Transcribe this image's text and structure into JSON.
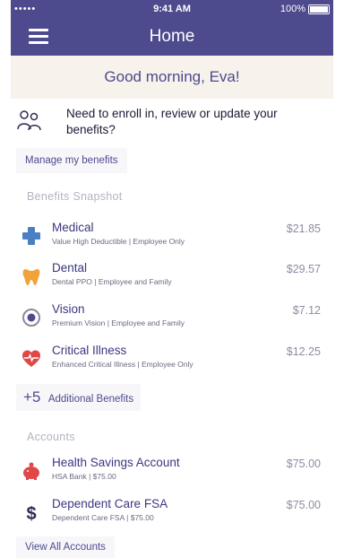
{
  "status": {
    "signal": "••••• ",
    "time": "9:41 AM",
    "battery": "100%"
  },
  "nav": {
    "title": "Home"
  },
  "greeting": "Good morning, Eva!",
  "enroll": {
    "text": "Need to enroll in, review or update your benefits?"
  },
  "manage_button": "Manage my benefits",
  "benefits_label": "Benefits Snapshot",
  "benefits": [
    {
      "title": "Medical",
      "sub": "Value High Deductible | Employee Only",
      "amount": "$21.85",
      "icon": "medical-cross-icon",
      "color": "#4a7fc2"
    },
    {
      "title": "Dental",
      "sub": "Dental PPO | Employee and Family",
      "amount": "$29.57",
      "icon": "tooth-icon",
      "color": "#f2a23a"
    },
    {
      "title": "Vision",
      "sub": "Premium Vision | Employee and Family",
      "amount": "$7.12",
      "icon": "eye-icon",
      "color": "#8c8a9e"
    },
    {
      "title": "Critical Illness",
      "sub": "Enhanced Critical Illness | Employee Only",
      "amount": "$12.25",
      "icon": "heart-pulse-icon",
      "color": "#e04848"
    }
  ],
  "additional": {
    "plus": "+5",
    "label": "Additional Benefits"
  },
  "accounts_label": "Accounts",
  "accounts": [
    {
      "title": "Health Savings Account",
      "sub": "HSA Bank | $75.00",
      "amount": "$75.00",
      "icon": "piggy-bank-icon",
      "color": "#e04848"
    },
    {
      "title": "Dependent Care FSA",
      "sub": "Dependent Care FSA | $75.00",
      "amount": "$75.00",
      "icon": "dollar-sign-icon",
      "color": "#2f2a57"
    }
  ],
  "view_all": "View All Accounts"
}
